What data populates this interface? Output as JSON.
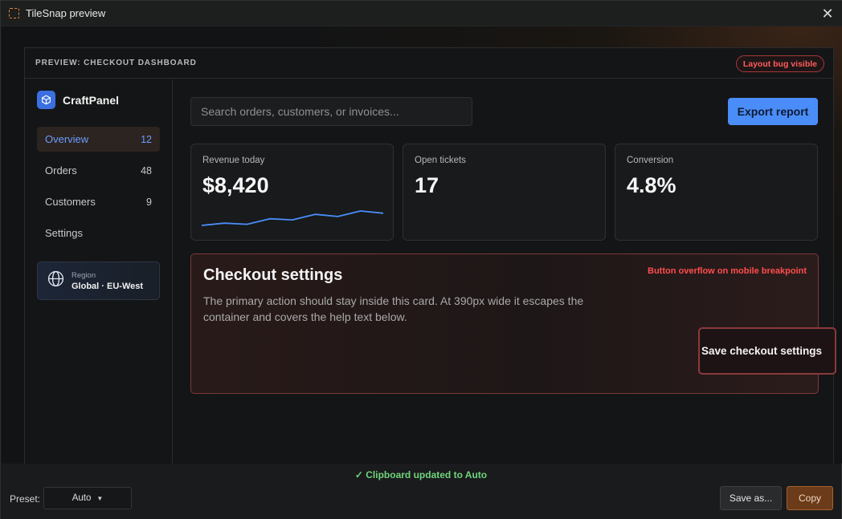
{
  "window": {
    "title": "TileSnap preview",
    "app_icon": "dashed-square-icon",
    "close_icon": "close-icon"
  },
  "preview": {
    "label": "PREVIEW: CHECKOUT DASHBOARD",
    "bug_badge": "Layout bug visible",
    "sidebar": {
      "brand": "CraftPanel",
      "brand_icon": "cube-icon",
      "items": [
        {
          "label": "Overview",
          "count": "12",
          "active": true
        },
        {
          "label": "Orders",
          "count": "48"
        },
        {
          "label": "Customers",
          "count": "9"
        },
        {
          "label": "Settings",
          "count": ""
        }
      ],
      "region": {
        "icon": "globe-icon",
        "label": "Region",
        "value": "Global · EU-West"
      }
    },
    "search": {
      "placeholder": "Search orders, customers, or invoices..."
    },
    "export_label": "Export report",
    "stats": [
      {
        "label": "Revenue today",
        "value": "$8,420",
        "sparkline": [
          2,
          4,
          3,
          8,
          7,
          12,
          10,
          15,
          13
        ]
      },
      {
        "label": "Open tickets",
        "value": "17"
      },
      {
        "label": "Conversion",
        "value": "4.8%"
      }
    ],
    "settings_card": {
      "title": "Checkout settings",
      "description": "The primary action should stay inside this card. At 390px wide it escapes the container and covers the help text below.",
      "warning": "Button overflow on mobile breakpoint",
      "button_label": "Save checkout settings"
    }
  },
  "footer": {
    "status": "✓ Clipboard updated to Auto",
    "preset_label": "Preset:",
    "preset_value": "Auto",
    "save_as_label": "Save as...",
    "copy_label": "Copy"
  },
  "colors": {
    "accent": "#4a8df8",
    "warning": "#ff4d4d",
    "success": "#6fd47c",
    "copy": "#6b3b1a"
  }
}
